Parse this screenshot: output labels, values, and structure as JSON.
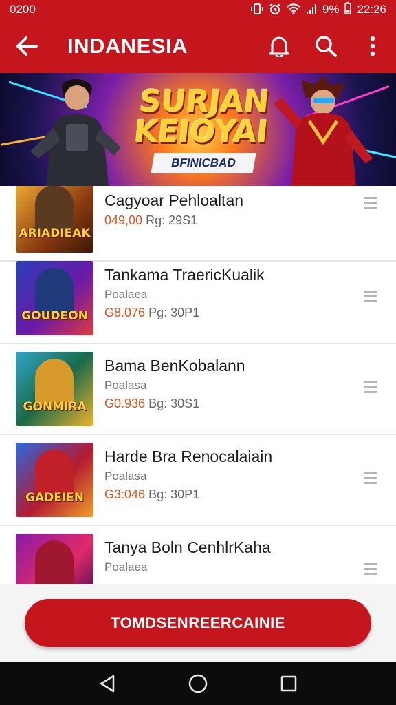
{
  "status_bar": {
    "time_left": "0200",
    "battery": "9%",
    "clock": "22:26"
  },
  "app_bar": {
    "title": "INDANESIA"
  },
  "banner": {
    "title_line1": "SURJAN",
    "title_line2": "KEIOYAI",
    "subtitle": "BFINICBAD"
  },
  "items": [
    {
      "name": "Cagyoar Pehloaltan",
      "sub": "",
      "price_value": "049,00",
      "price_meta": "Rg: 29S1",
      "thumb_label": "ARIADIEAK"
    },
    {
      "name": "Tankama TraericKualik",
      "sub": "Poalaea",
      "price_value": "G8.076",
      "price_meta": "Pg: 30P1",
      "thumb_label": "GOUDEON"
    },
    {
      "name": "Bama BenKobalann",
      "sub": "Poalasa",
      "price_value": "G0.936",
      "price_meta": "Bg: 30S1",
      "thumb_label": "GONMIRA"
    },
    {
      "name": "Harde Bra Renocalaiain",
      "sub": "Poalasa",
      "price_value": "G3:046",
      "price_meta": "Bg: 30P1",
      "thumb_label": "GADEIEN"
    },
    {
      "name": "Tanya Boln CenhlrKaha",
      "sub": "Poalaea",
      "price_value": "",
      "price_meta": "",
      "thumb_label": ""
    }
  ],
  "cta": {
    "label": "TOMDSENREERCAINIE"
  },
  "colors": {
    "brand_red": "#c4161c",
    "price_orange": "#d9541c"
  },
  "icons": [
    "back-arrow-icon",
    "bell-icon",
    "search-icon",
    "more-vert-icon",
    "drag-handle-icon",
    "nav-back-icon",
    "nav-home-icon",
    "nav-recents-icon"
  ]
}
